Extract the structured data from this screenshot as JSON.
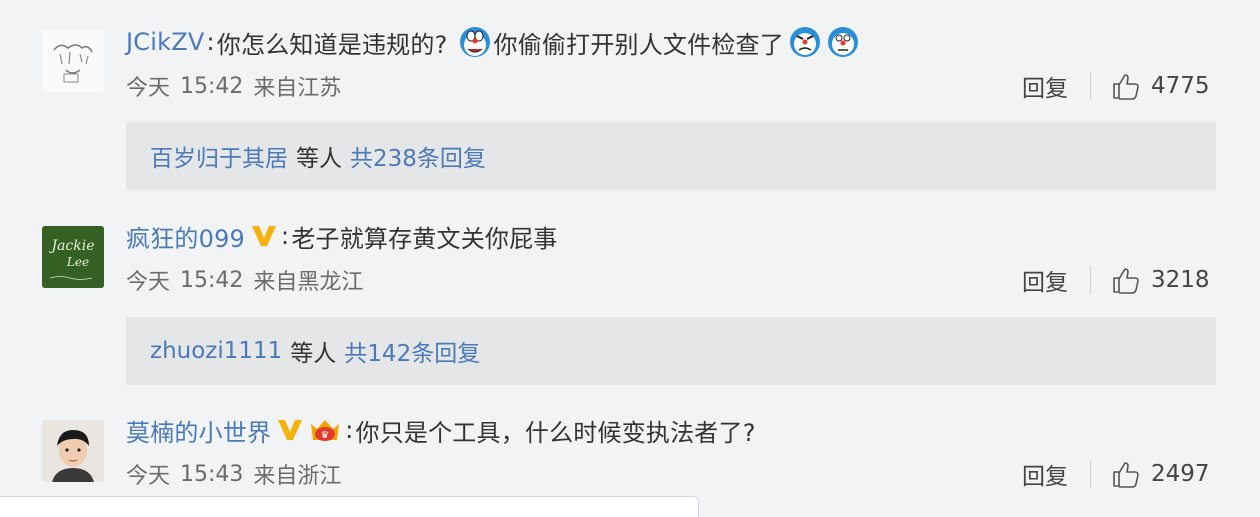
{
  "comments": [
    {
      "username": "JCikZV",
      "text_1": "你怎么知道是违规的?",
      "text_2": "你偷偷打开别人文件检查了",
      "time_label": "今天",
      "time": "15:42",
      "source": "来自江苏",
      "reply_label": "回复",
      "likes": "4775",
      "replies": {
        "who": "百岁归于其居",
        "etc": "等人",
        "count": "共238条回复"
      }
    },
    {
      "username": "疯狂的099",
      "text_1": "老子就算存黄文关你屁事",
      "time_label": "今天",
      "time": "15:42",
      "source": "来自黑龙江",
      "reply_label": "回复",
      "likes": "3218",
      "replies": {
        "who": "zhuozi1111",
        "etc": "等人",
        "count": "共142条回复"
      }
    },
    {
      "username": "莫楠的小世界",
      "text_1": "你只是个工具，什么时候变执法者了?",
      "time_label": "今天",
      "time": "15:43",
      "source": "来自浙江",
      "reply_label": "回复",
      "likes": "2497"
    }
  ],
  "avatar_text": {
    "line1": "Jackie",
    "line2": "Lee"
  },
  "colors": {
    "username": "#4a7ab8",
    "background": "#f2f3f5",
    "reply_box": "#e5e6e8",
    "vip_badge": "#f5b20a"
  },
  "icons": [
    "doraemon-emoji",
    "v-badge-icon",
    "crown-badge-icon",
    "thumbs-up-icon"
  ]
}
